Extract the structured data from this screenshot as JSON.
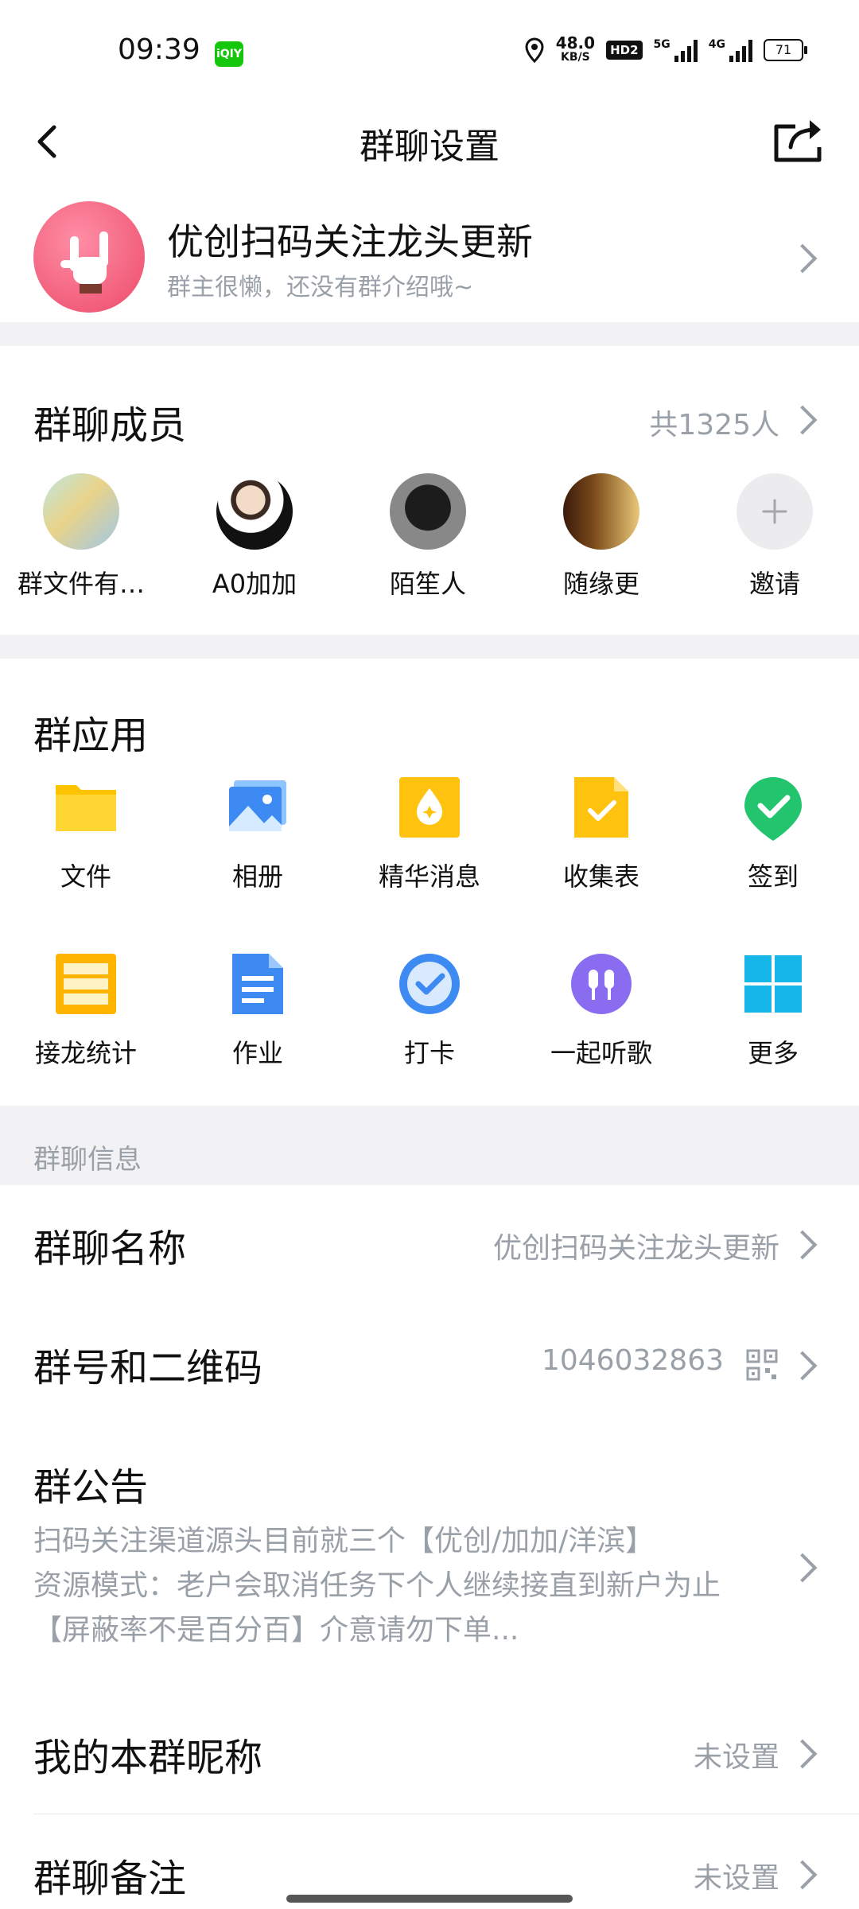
{
  "status": {
    "time": "09:39",
    "app_badge": "iQIY",
    "speed_value": "48.0",
    "speed_unit": "KB/S",
    "hd": "HD2",
    "sig1": "5G",
    "sig2": "4G",
    "battery": "71"
  },
  "nav": {
    "title": "群聊设置"
  },
  "group": {
    "name": "优创扫码关注龙头更新",
    "intro": "群主很懒，还没有群介绍哦~"
  },
  "members": {
    "title": "群聊成员",
    "count": "共1325人",
    "items": [
      {
        "name": "群文件有…"
      },
      {
        "name": "A0加加"
      },
      {
        "name": "陌笙人"
      },
      {
        "name": "随缘更"
      },
      {
        "name": "邀请"
      }
    ]
  },
  "apps": {
    "title": "群应用",
    "items": [
      {
        "label": "文件",
        "icon": "folder-icon"
      },
      {
        "label": "相册",
        "icon": "album-icon"
      },
      {
        "label": "精华消息",
        "icon": "essence-icon"
      },
      {
        "label": "收集表",
        "icon": "form-icon"
      },
      {
        "label": "签到",
        "icon": "checkin-icon"
      },
      {
        "label": "接龙统计",
        "icon": "relay-icon"
      },
      {
        "label": "作业",
        "icon": "homework-icon"
      },
      {
        "label": "打卡",
        "icon": "punch-icon"
      },
      {
        "label": "一起听歌",
        "icon": "music-icon"
      },
      {
        "label": "更多",
        "icon": "more-icon"
      }
    ]
  },
  "info": {
    "header": "群聊信息",
    "name_label": "群聊名称",
    "name_value": "优创扫码关注龙头更新",
    "id_label": "群号和二维码",
    "id_value": "1046032863",
    "notice_label": "群公告",
    "notice_lines": [
      "扫码关注渠道源头目前就三个【优创/加加/洋滨】",
      "资源模式：老户会取消任务下个人继续接直到新户为止",
      "【屏蔽率不是百分百】介意请勿下单..."
    ],
    "nickname_label": "我的本群昵称",
    "nickname_value": "未设置",
    "remark_label": "群聊备注",
    "remark_value": "未设置"
  },
  "colors": {
    "accent_blue": "#3d8bf2",
    "gray_text": "#9aa0a8",
    "separator": "#f2f2f4"
  }
}
